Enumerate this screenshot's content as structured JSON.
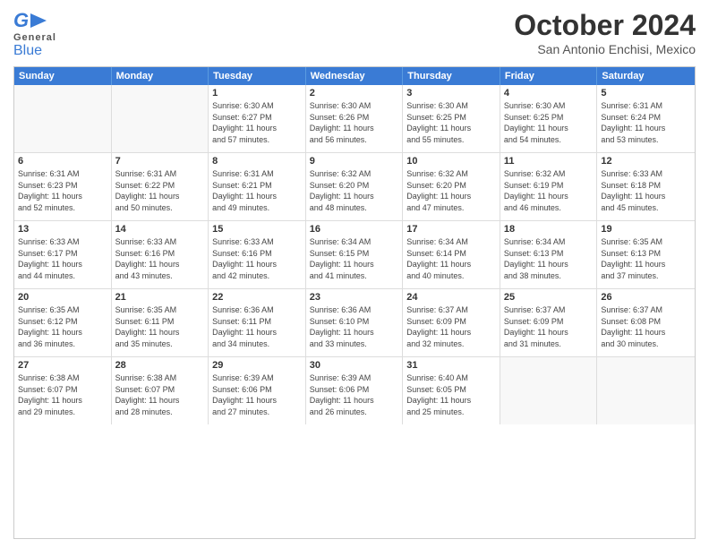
{
  "header": {
    "logo_general": "General",
    "logo_blue": "Blue",
    "month_title": "October 2024",
    "location": "San Antonio Enchisi, Mexico"
  },
  "weekdays": [
    "Sunday",
    "Monday",
    "Tuesday",
    "Wednesday",
    "Thursday",
    "Friday",
    "Saturday"
  ],
  "weeks": [
    {
      "days": [
        {
          "num": "",
          "lines": []
        },
        {
          "num": "",
          "lines": []
        },
        {
          "num": "1",
          "lines": [
            "Sunrise: 6:30 AM",
            "Sunset: 6:27 PM",
            "Daylight: 11 hours",
            "and 57 minutes."
          ]
        },
        {
          "num": "2",
          "lines": [
            "Sunrise: 6:30 AM",
            "Sunset: 6:26 PM",
            "Daylight: 11 hours",
            "and 56 minutes."
          ]
        },
        {
          "num": "3",
          "lines": [
            "Sunrise: 6:30 AM",
            "Sunset: 6:25 PM",
            "Daylight: 11 hours",
            "and 55 minutes."
          ]
        },
        {
          "num": "4",
          "lines": [
            "Sunrise: 6:30 AM",
            "Sunset: 6:25 PM",
            "Daylight: 11 hours",
            "and 54 minutes."
          ]
        },
        {
          "num": "5",
          "lines": [
            "Sunrise: 6:31 AM",
            "Sunset: 6:24 PM",
            "Daylight: 11 hours",
            "and 53 minutes."
          ]
        }
      ]
    },
    {
      "days": [
        {
          "num": "6",
          "lines": [
            "Sunrise: 6:31 AM",
            "Sunset: 6:23 PM",
            "Daylight: 11 hours",
            "and 52 minutes."
          ]
        },
        {
          "num": "7",
          "lines": [
            "Sunrise: 6:31 AM",
            "Sunset: 6:22 PM",
            "Daylight: 11 hours",
            "and 50 minutes."
          ]
        },
        {
          "num": "8",
          "lines": [
            "Sunrise: 6:31 AM",
            "Sunset: 6:21 PM",
            "Daylight: 11 hours",
            "and 49 minutes."
          ]
        },
        {
          "num": "9",
          "lines": [
            "Sunrise: 6:32 AM",
            "Sunset: 6:20 PM",
            "Daylight: 11 hours",
            "and 48 minutes."
          ]
        },
        {
          "num": "10",
          "lines": [
            "Sunrise: 6:32 AM",
            "Sunset: 6:20 PM",
            "Daylight: 11 hours",
            "and 47 minutes."
          ]
        },
        {
          "num": "11",
          "lines": [
            "Sunrise: 6:32 AM",
            "Sunset: 6:19 PM",
            "Daylight: 11 hours",
            "and 46 minutes."
          ]
        },
        {
          "num": "12",
          "lines": [
            "Sunrise: 6:33 AM",
            "Sunset: 6:18 PM",
            "Daylight: 11 hours",
            "and 45 minutes."
          ]
        }
      ]
    },
    {
      "days": [
        {
          "num": "13",
          "lines": [
            "Sunrise: 6:33 AM",
            "Sunset: 6:17 PM",
            "Daylight: 11 hours",
            "and 44 minutes."
          ]
        },
        {
          "num": "14",
          "lines": [
            "Sunrise: 6:33 AM",
            "Sunset: 6:16 PM",
            "Daylight: 11 hours",
            "and 43 minutes."
          ]
        },
        {
          "num": "15",
          "lines": [
            "Sunrise: 6:33 AM",
            "Sunset: 6:16 PM",
            "Daylight: 11 hours",
            "and 42 minutes."
          ]
        },
        {
          "num": "16",
          "lines": [
            "Sunrise: 6:34 AM",
            "Sunset: 6:15 PM",
            "Daylight: 11 hours",
            "and 41 minutes."
          ]
        },
        {
          "num": "17",
          "lines": [
            "Sunrise: 6:34 AM",
            "Sunset: 6:14 PM",
            "Daylight: 11 hours",
            "and 40 minutes."
          ]
        },
        {
          "num": "18",
          "lines": [
            "Sunrise: 6:34 AM",
            "Sunset: 6:13 PM",
            "Daylight: 11 hours",
            "and 38 minutes."
          ]
        },
        {
          "num": "19",
          "lines": [
            "Sunrise: 6:35 AM",
            "Sunset: 6:13 PM",
            "Daylight: 11 hours",
            "and 37 minutes."
          ]
        }
      ]
    },
    {
      "days": [
        {
          "num": "20",
          "lines": [
            "Sunrise: 6:35 AM",
            "Sunset: 6:12 PM",
            "Daylight: 11 hours",
            "and 36 minutes."
          ]
        },
        {
          "num": "21",
          "lines": [
            "Sunrise: 6:35 AM",
            "Sunset: 6:11 PM",
            "Daylight: 11 hours",
            "and 35 minutes."
          ]
        },
        {
          "num": "22",
          "lines": [
            "Sunrise: 6:36 AM",
            "Sunset: 6:11 PM",
            "Daylight: 11 hours",
            "and 34 minutes."
          ]
        },
        {
          "num": "23",
          "lines": [
            "Sunrise: 6:36 AM",
            "Sunset: 6:10 PM",
            "Daylight: 11 hours",
            "and 33 minutes."
          ]
        },
        {
          "num": "24",
          "lines": [
            "Sunrise: 6:37 AM",
            "Sunset: 6:09 PM",
            "Daylight: 11 hours",
            "and 32 minutes."
          ]
        },
        {
          "num": "25",
          "lines": [
            "Sunrise: 6:37 AM",
            "Sunset: 6:09 PM",
            "Daylight: 11 hours",
            "and 31 minutes."
          ]
        },
        {
          "num": "26",
          "lines": [
            "Sunrise: 6:37 AM",
            "Sunset: 6:08 PM",
            "Daylight: 11 hours",
            "and 30 minutes."
          ]
        }
      ]
    },
    {
      "days": [
        {
          "num": "27",
          "lines": [
            "Sunrise: 6:38 AM",
            "Sunset: 6:07 PM",
            "Daylight: 11 hours",
            "and 29 minutes."
          ]
        },
        {
          "num": "28",
          "lines": [
            "Sunrise: 6:38 AM",
            "Sunset: 6:07 PM",
            "Daylight: 11 hours",
            "and 28 minutes."
          ]
        },
        {
          "num": "29",
          "lines": [
            "Sunrise: 6:39 AM",
            "Sunset: 6:06 PM",
            "Daylight: 11 hours",
            "and 27 minutes."
          ]
        },
        {
          "num": "30",
          "lines": [
            "Sunrise: 6:39 AM",
            "Sunset: 6:06 PM",
            "Daylight: 11 hours",
            "and 26 minutes."
          ]
        },
        {
          "num": "31",
          "lines": [
            "Sunrise: 6:40 AM",
            "Sunset: 6:05 PM",
            "Daylight: 11 hours",
            "and 25 minutes."
          ]
        },
        {
          "num": "",
          "lines": []
        },
        {
          "num": "",
          "lines": []
        }
      ]
    }
  ]
}
